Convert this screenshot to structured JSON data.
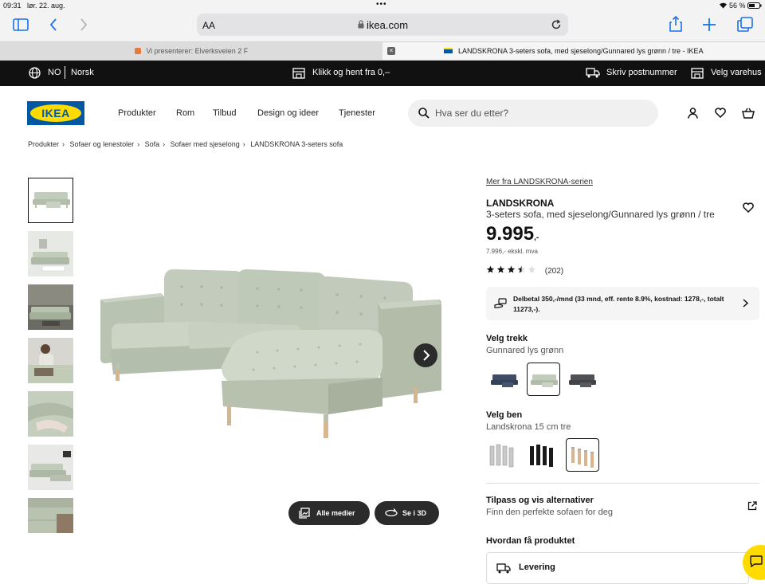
{
  "status_bar": {
    "time": "09:31",
    "date": "lør. 22. aug.",
    "battery": "56 %"
  },
  "browser": {
    "text_size_label": "AA",
    "url": "ikea.com",
    "tabs": [
      {
        "label": "Vi presenterer: Elverksveien 2 F",
        "active": false
      },
      {
        "label": "LANDSKRONA 3-seters sofa, med sjeselong/Gunnared lys grønn / tre - IKEA",
        "active": true
      }
    ]
  },
  "topbar": {
    "country": "NO",
    "language": "Norsk",
    "click_collect": "Klikk og hent fra 0,–",
    "postcode": "Skriv postnummer",
    "store": "Velg varehus"
  },
  "header": {
    "logo": "IKEA",
    "nav": [
      "Produkter",
      "Rom",
      "Tilbud",
      "Design og ideer",
      "Tjenester"
    ],
    "search_placeholder": "Hva ser du etter?"
  },
  "breadcrumb": [
    "Produkter",
    "Sofaer og lenestoler",
    "Sofa",
    "Sofaer med sjeselong",
    "LANDSKRONA 3-seters sofa"
  ],
  "gallery": {
    "thumbnail_count": 7,
    "selected_index": 0,
    "all_media_label": "Alle medier",
    "view_3d_label": "Se i 3D"
  },
  "product": {
    "series_link": "Mer fra LANDSKRONA-serien",
    "name": "LANDSKRONA",
    "description": "3-seters sofa, med sjeselong/Gunnared lys grønn / tre",
    "price": "9.995",
    "price_suffix": ",-",
    "price_ex_vat": "7.996,- ekskl. mva",
    "rating_value": 3.5,
    "rating_max": 5,
    "review_count": "(202)",
    "finance_text": "Delbetal 350,-/mnd (33 mnd, eff. rente 8.9%, kostnad: 1278,-, totalt 11273,-)."
  },
  "cover": {
    "label": "Velg trekk",
    "selected": "Gunnared lys grønn",
    "options": [
      {
        "color": "#3e4c66",
        "selected": false
      },
      {
        "color": "#c2ccbb",
        "selected": true
      },
      {
        "color": "#4d5054",
        "selected": false
      }
    ]
  },
  "legs": {
    "label": "Velg ben",
    "selected": "Landskrona 15 cm tre",
    "options": [
      {
        "color": "#c9c9c9",
        "selected": false
      },
      {
        "color": "#1a1a1a",
        "selected": false
      },
      {
        "color": "#d9b48c",
        "selected": true
      }
    ]
  },
  "customize": {
    "title": "Tilpass og vis alternativer",
    "subtitle": "Finn den perfekte sofaen for deg"
  },
  "delivery": {
    "title": "Hvordan få produktet",
    "option": "Levering"
  },
  "colors": {
    "brand_blue": "#0058a3",
    "brand_yellow": "#ffdb00",
    "sofa_green": "#c2ccbb"
  }
}
